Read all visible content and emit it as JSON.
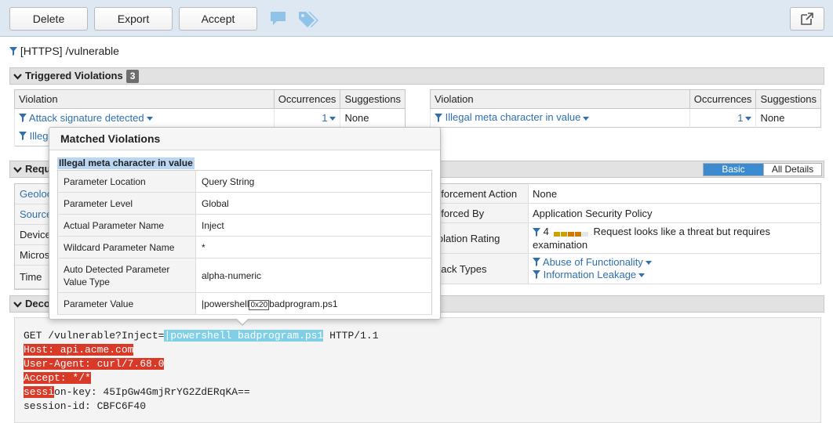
{
  "toolbar": {
    "delete_label": "Delete",
    "export_label": "Export",
    "accept_label": "Accept",
    "icons": [
      "comment-icon",
      "tags-icon",
      "external-link-icon"
    ]
  },
  "path": "[HTTPS] /vulnerable",
  "triggered": {
    "title": "Triggered Violations",
    "count": "3",
    "headers": [
      "Violation",
      "Occurrences",
      "Suggestions"
    ],
    "left_rows": [
      {
        "violation": "Attack signature detected",
        "occurrences": "1",
        "suggestion": "None"
      },
      {
        "violation": "Illeg",
        "occurrences": "",
        "suggestion": ""
      }
    ],
    "right_rows": [
      {
        "violation": "Illegal meta character in value",
        "occurrences": "1",
        "suggestion": "None"
      }
    ]
  },
  "request": {
    "title": "Requ",
    "toggle_basic": "Basic",
    "toggle_all": "All Details",
    "left_labels": [
      "Geoloc",
      "Source",
      "Device",
      "Micros",
      "Time"
    ],
    "right_rows": [
      {
        "label": "nforcement Action",
        "value": "None"
      },
      {
        "label": "nforced By",
        "value": "Application Security Policy"
      },
      {
        "label": "iolation Rating",
        "rating": "4",
        "value": "Request looks like a threat but requires examination"
      },
      {
        "label": "ttack Types",
        "links": [
          "Abuse of Functionality",
          "Information Leakage"
        ]
      }
    ],
    "rating_level": 0.8
  },
  "decoded": {
    "title": "Deco",
    "lines": {
      "l1_pre": "GET /vulnerable?Inject=",
      "l1_hl": "|powershell badprogram.ps1",
      "l1_post": " HTTP/1.1",
      "l2": "Host: api.acme.com",
      "l3": "User-Agent: curl/7.68.0",
      "l4": "Accept: */*",
      "l5_hl": "sessi",
      "l5_rest": "on-key: 45IpGw4GmjRrYG2ZdERqKA==",
      "l6": "session-id: CBFC6F40"
    }
  },
  "popup": {
    "title": "Matched Violations",
    "subtitle": "Illegal meta character in value",
    "rows": [
      {
        "label": "Parameter Location",
        "value": "Query String"
      },
      {
        "label": "Parameter Level",
        "value": "Global"
      },
      {
        "label": "Actual Parameter Name",
        "value": "Inject"
      },
      {
        "label": "Wildcard Parameter Name",
        "value": "*"
      },
      {
        "label": "Auto Detected Parameter Value Type",
        "value": "alpha-numeric"
      }
    ],
    "param_value_label": "Parameter Value",
    "param_value_pre": "|powershell",
    "param_value_hex": "0x20",
    "param_value_post": "badprogram.ps1"
  }
}
